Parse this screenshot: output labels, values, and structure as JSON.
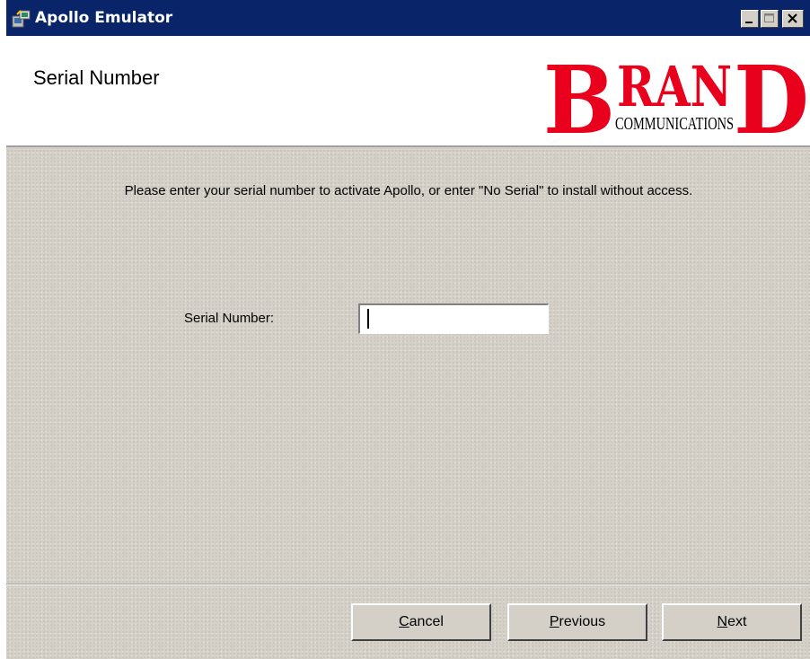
{
  "window": {
    "title": "Apollo Emulator",
    "icon": "installer-app-icon",
    "controls": [
      "minimize-icon",
      "maximize-icon",
      "close-icon"
    ]
  },
  "header": {
    "title": "Serial Number",
    "logo": {
      "main": "BRAND",
      "sub": "COMMUNICATIONS",
      "color": "#e8001c"
    }
  },
  "content": {
    "instructions": "Please enter your serial number to activate Apollo, or enter \"No Serial\" to install without access.",
    "serial_label": "Serial Number:",
    "serial_value": ""
  },
  "buttons": {
    "cancel": {
      "first": "C",
      "rest": "ancel"
    },
    "previous": {
      "first": "P",
      "rest": "revious"
    },
    "next": {
      "first": "N",
      "rest": "ext"
    }
  },
  "colors": {
    "titlebar": "#0a246a",
    "face": "#d4d0c8"
  }
}
